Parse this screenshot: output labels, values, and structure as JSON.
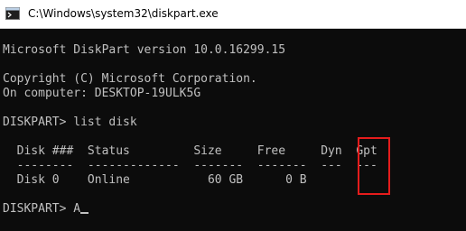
{
  "window": {
    "title": "C:\\Windows\\system32\\diskpart.exe"
  },
  "console": {
    "version_line": "Microsoft DiskPart version 10.0.16299.15",
    "copyright_line": "Copyright (C) Microsoft Corporation.",
    "computer_line": "On computer: DESKTOP-19ULK5G",
    "command_line": "DISKPART> list disk",
    "table_header": "  Disk ###  Status         Size     Free     Dyn  Gpt",
    "table_separator": "  --------  -------------  -------  -------  ---  ---",
    "table_rows": [
      "  Disk 0    Online           60 GB      0 B"
    ],
    "prompt_line": "DISKPART> A"
  },
  "colors": {
    "background": "#0c0c0c",
    "text": "#c0c0c0",
    "highlight_box": "#e51c1c"
  }
}
